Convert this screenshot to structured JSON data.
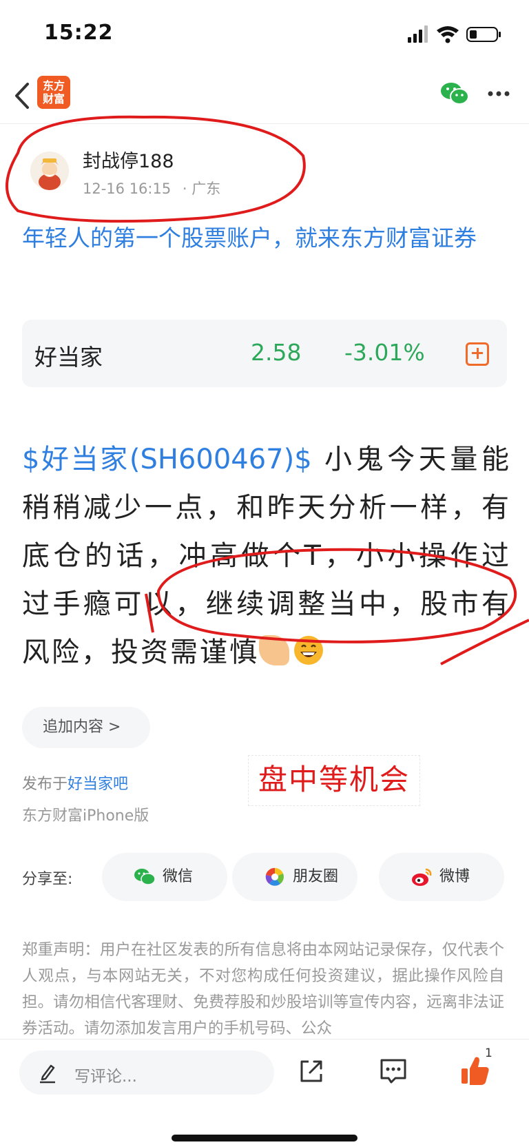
{
  "status_bar": {
    "time": "15:22"
  },
  "nav": {
    "logo_text_line1": "东方",
    "logo_text_line2": "财富",
    "colors": {
      "brand": "#f05a23",
      "wechat": "#2bb24c"
    }
  },
  "author": {
    "name": "封战停188",
    "datetime": "12-16 16:15",
    "location": "· 广东"
  },
  "ad_link": "年轻人的第一个股票账户，就来东方财富证券",
  "stock_card": {
    "name": "好当家",
    "price": "2.58",
    "change": "-3.01%",
    "color": "#2da85a"
  },
  "post": {
    "stock_tag": "$好当家(SH600467)$",
    "text": " 小鬼今天量能稍稍减少一点，和昨天分析一样，有底仓的话，冲高做个T，小小操作过过手瘾可以，继续调整当中，股市有风险，投资需谨慎"
  },
  "add_content_label": "追加内容 >",
  "posted_in": {
    "prefix": "发布于",
    "forum": "好当家吧"
  },
  "platform": "东方财富iPhone版",
  "annotation": "盘中等机会",
  "share": {
    "label": "分享至:",
    "buttons": [
      {
        "label": "微信",
        "icon": "wechat-icon"
      },
      {
        "label": "朋友圈",
        "icon": "moments-icon"
      },
      {
        "label": "微博",
        "icon": "weibo-icon"
      }
    ]
  },
  "disclaimer": "郑重声明：用户在社区发表的所有信息将由本网站记录保存，仅代表个人观点，与本网站无关，不对您构成任何投资建议，据此操作风险自担。请勿相信代客理财、免费荐股和炒股培训等宣传内容，远离非法证券活动。请勿添加发言用户的手机号码、公众",
  "bottom_bar": {
    "comment_placeholder": "写评论...",
    "like_count": "1"
  }
}
